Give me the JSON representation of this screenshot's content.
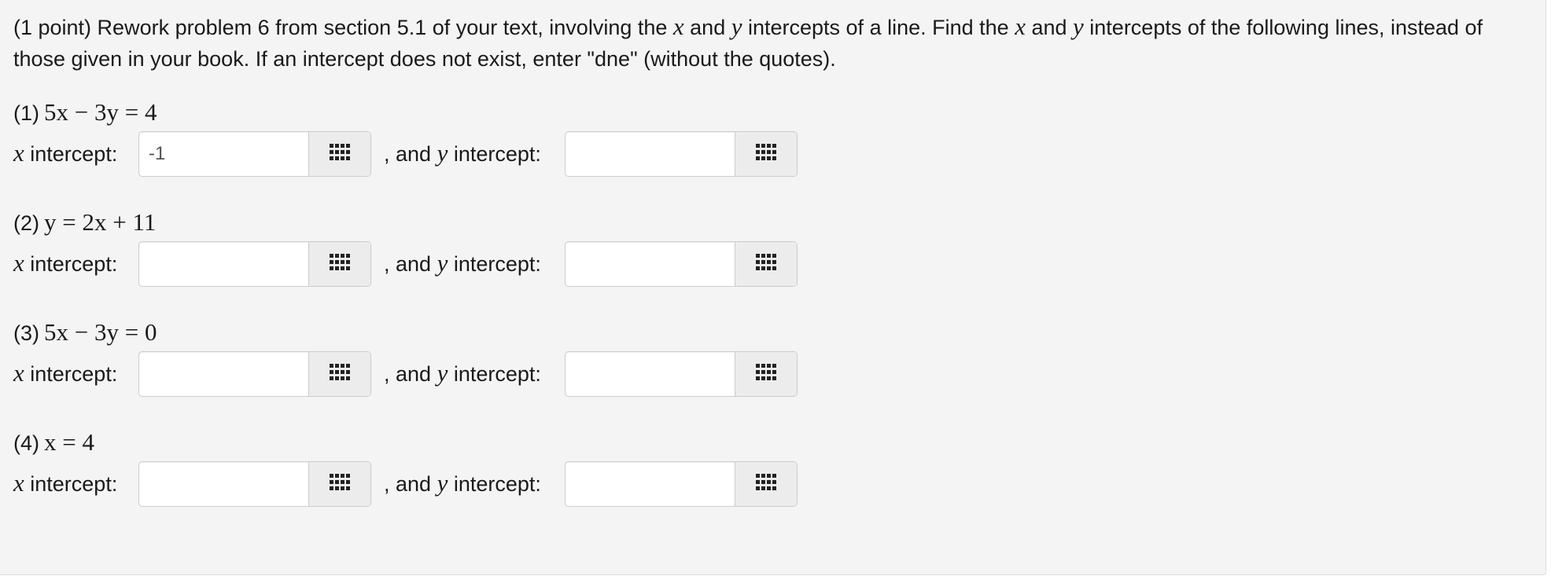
{
  "intro": {
    "part1": "(1 point) Rework problem 6 from section 5.1 of your text, involving the ",
    "var_x": "x",
    "part2": " and ",
    "var_y": "y",
    "part3": " intercepts of a line. Find the ",
    "part4": " intercepts of the following lines, instead of those given in your book. If an intercept does not exist, enter \"dne\" (without the quotes)."
  },
  "labels": {
    "x_var": "x",
    "x_intercept": " intercept:",
    "and_prefix": ", and ",
    "y_var": "y",
    "y_intercept": " intercept:"
  },
  "problems": [
    {
      "number": "(1)",
      "equation": "5x − 3y = 4",
      "x_value": "-1",
      "y_value": ""
    },
    {
      "number": "(2)",
      "equation": "y = 2x + 11",
      "x_value": "",
      "y_value": ""
    },
    {
      "number": "(3)",
      "equation": "5x − 3y = 0",
      "x_value": "",
      "y_value": ""
    },
    {
      "number": "(4)",
      "equation": "x = 4",
      "x_value": "",
      "y_value": ""
    }
  ],
  "icons": {
    "palette": "keypad-grid-icon"
  },
  "colors": {
    "panel_bg": "#f4f4f4",
    "icon": "#222222",
    "input_border": "#cccccc"
  }
}
